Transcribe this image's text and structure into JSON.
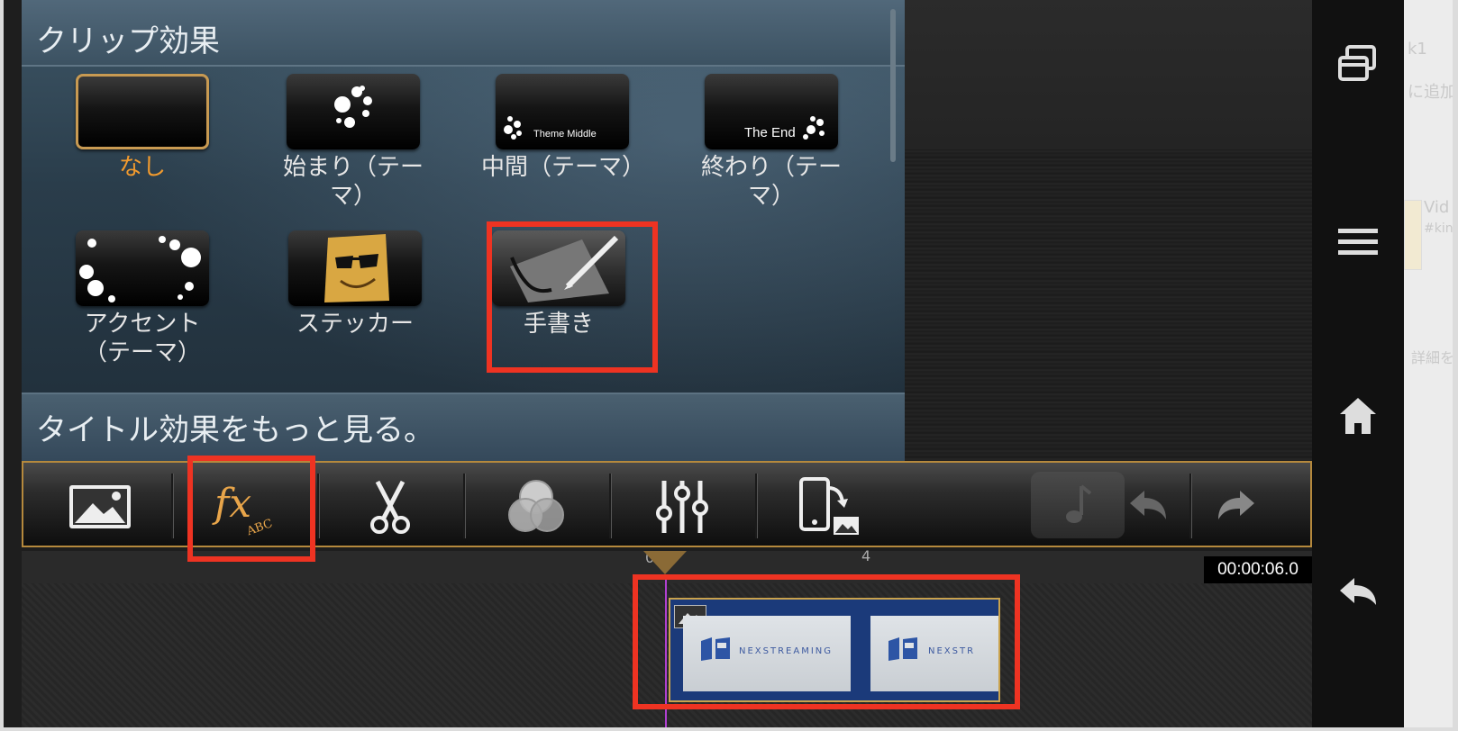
{
  "panel": {
    "title": "クリップ効果",
    "more_label": "タイトル効果をもっと見る。"
  },
  "effects": [
    {
      "label": "なし",
      "selected": true
    },
    {
      "label": "始まり（テーマ）",
      "thumb_text": ""
    },
    {
      "label": "中間（テーマ）",
      "thumb_text": "Theme Middle"
    },
    {
      "label": "終わり（テーマ）",
      "thumb_text": "The End"
    },
    {
      "label": "アクセント（テーマ）"
    },
    {
      "label": "ステッカー"
    },
    {
      "label": "手書き"
    }
  ],
  "toolbar": {
    "fx_main": "fx",
    "fx_sub": "ABC",
    "tools": [
      "image-icon",
      "fx-abc-icon",
      "scissors-icon",
      "color-circles-icon",
      "sliders-icon",
      "phone-rotate-icon",
      "music-note-icon",
      "undo-icon",
      "redo-icon"
    ]
  },
  "timeline": {
    "playhead_label": "0:0",
    "ruler_tick": "4",
    "timecode": "00:00:06.0",
    "clip_brand": "NEXSTREAMING",
    "clip_brand_short": "NEXSTR"
  },
  "ghost": {
    "line1": "k1",
    "line2": "に追加",
    "line3": "Vid",
    "line4": "#kin",
    "line5": "詳細を"
  },
  "colors": {
    "accent_orange": "#f19a2e",
    "highlight_red": "#ee3322",
    "toolbar_border": "#b5893d",
    "playhead": "#b040d0"
  }
}
